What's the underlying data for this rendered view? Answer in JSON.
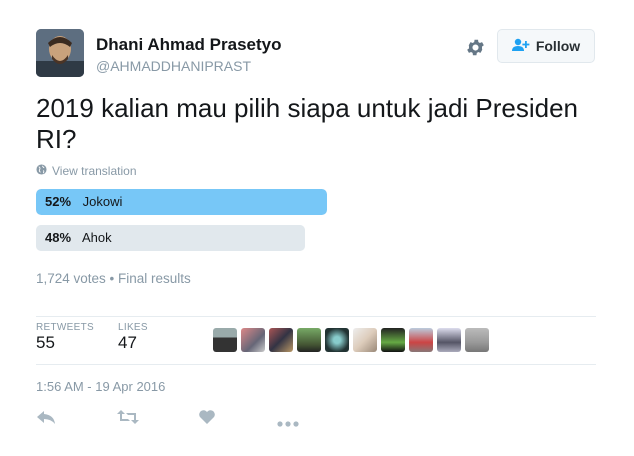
{
  "user": {
    "name": "Dhani Ahmad Prasetyo",
    "handle": "@AHMADDHANIPRAST"
  },
  "follow_label": "Follow",
  "tweet_text": "2019 kalian mau pilih siapa untuk jadi Presiden RI?",
  "translate_label": "View translation",
  "poll": {
    "options": [
      {
        "percent_label": "52%",
        "label": "Jokowi",
        "value": 52,
        "color": "#77c7f7",
        "winner": true
      },
      {
        "percent_label": "48%",
        "label": "Ahok",
        "value": 48,
        "color": "#e1e8ed",
        "winner": false
      }
    ],
    "summary": "1,724 votes • Final results"
  },
  "stats": {
    "retweets_label": "RETWEETS",
    "retweets_value": "55",
    "likes_label": "LIKES",
    "likes_value": "47"
  },
  "timestamp": "1:56 AM - 19 Apr 2016",
  "colors": {
    "text_secondary": "#8899a6",
    "winner_fill": "#77c7f7",
    "track": "#e1e8ed"
  }
}
